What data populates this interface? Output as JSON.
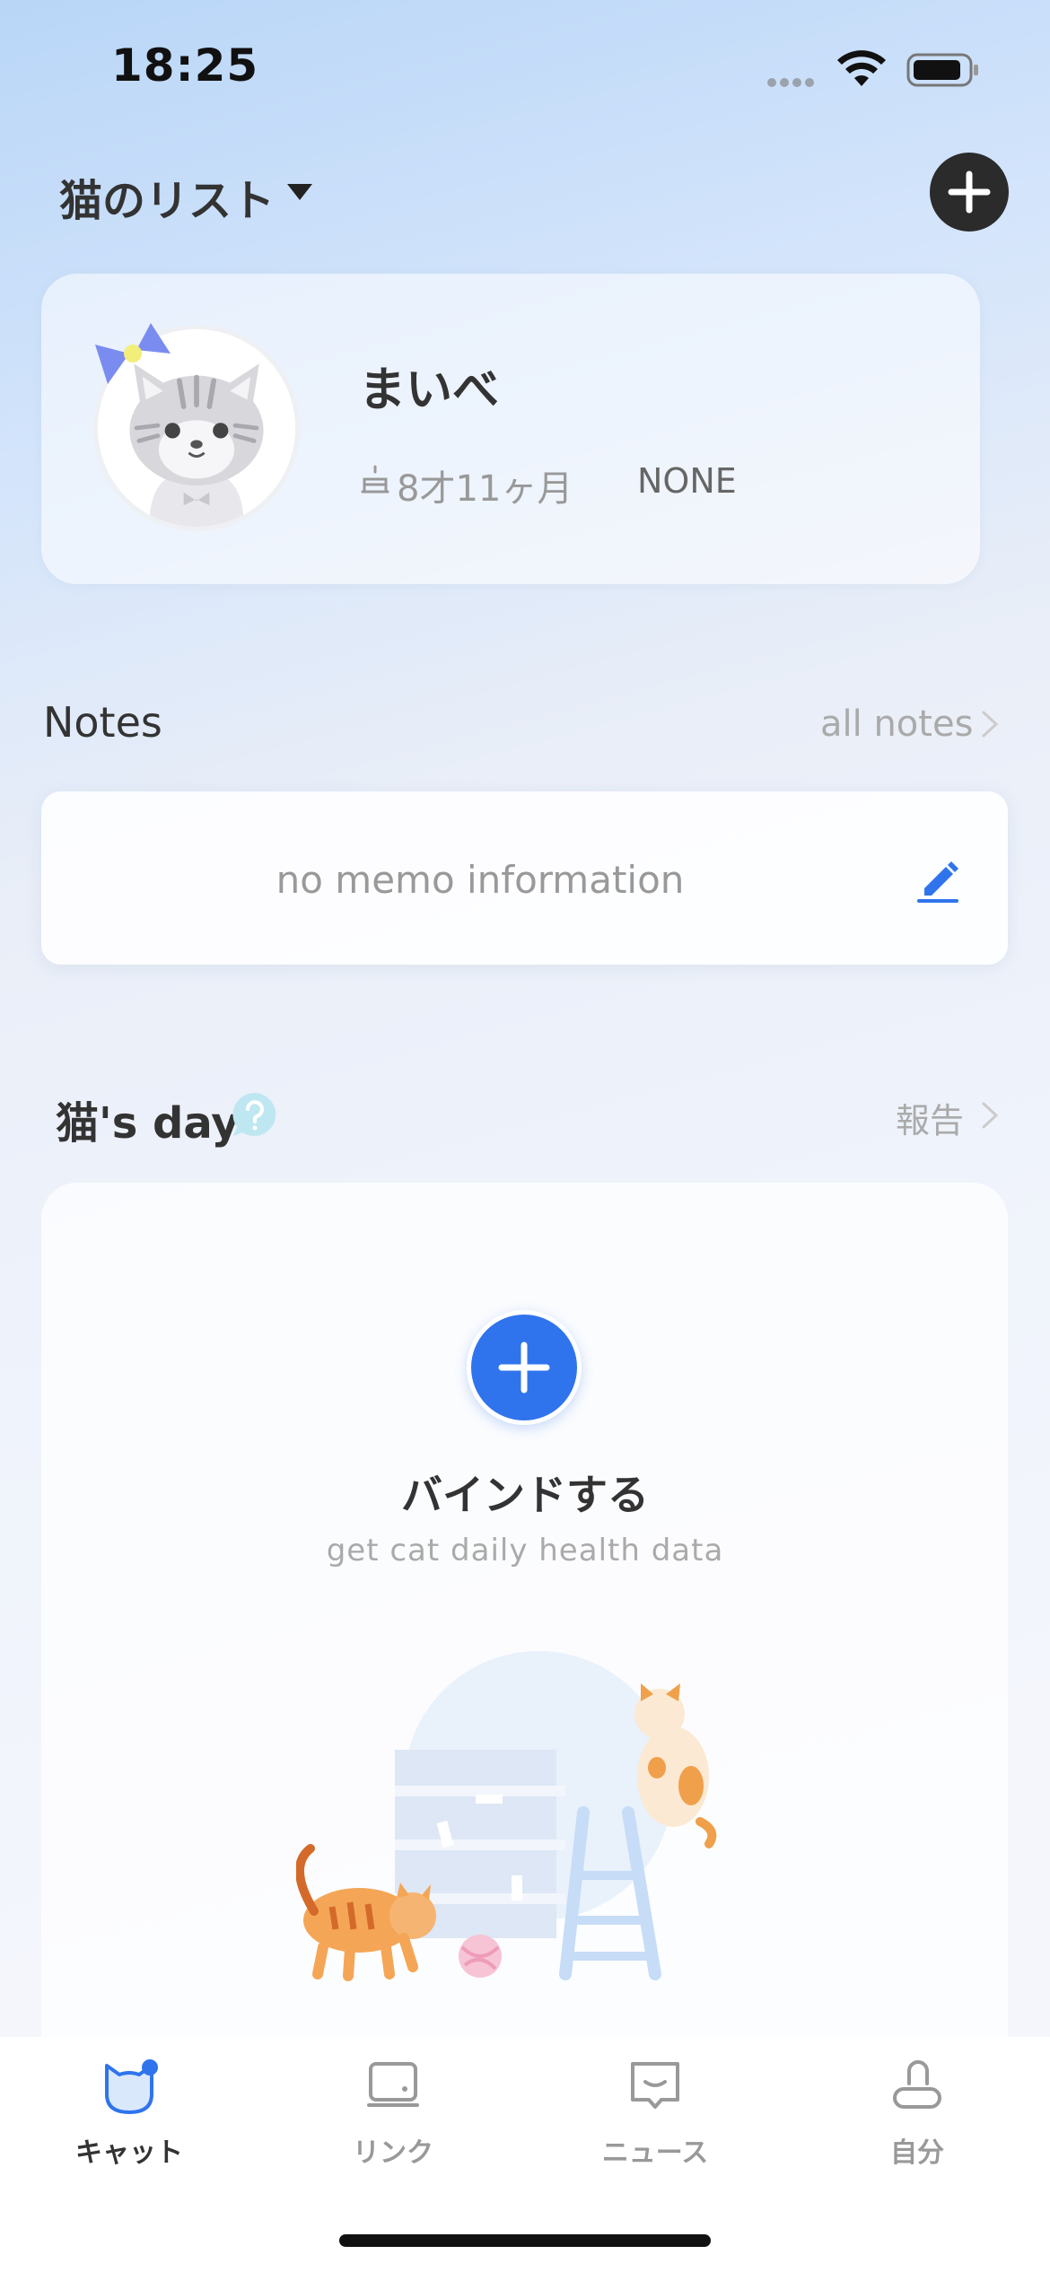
{
  "status_bar": {
    "time": "18:25"
  },
  "header": {
    "title": "猫のリスト"
  },
  "profile": {
    "name": "まいべ",
    "age": "8才11ヶ月",
    "breed": "NONE"
  },
  "notes": {
    "title": "Notes",
    "all_label": "all notes",
    "empty_text": "no memo information"
  },
  "day": {
    "title": "猫's day",
    "report_label": "報告",
    "bind_title": "バインドする",
    "bind_subtitle": "get cat daily health data"
  },
  "tabs": [
    {
      "label": "キャット",
      "icon": "cat-icon",
      "active": true
    },
    {
      "label": "リンク",
      "icon": "device-icon",
      "active": false
    },
    {
      "label": "ニュース",
      "icon": "message-icon",
      "active": false
    },
    {
      "label": "自分",
      "icon": "person-icon",
      "active": false
    }
  ],
  "colors": {
    "accent": "#2f74ec",
    "dark_button": "#2b2b2b",
    "text_primary": "#333333",
    "text_muted": "#aaaaaa"
  }
}
